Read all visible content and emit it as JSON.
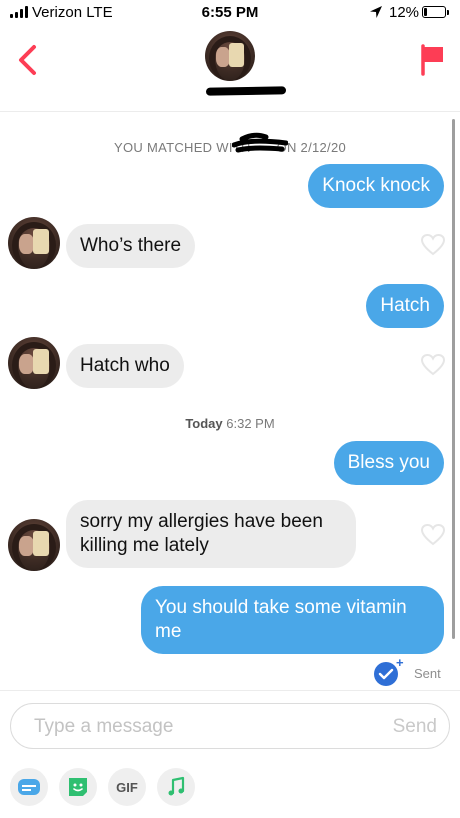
{
  "status_bar": {
    "carrier": "Verizon  LTE",
    "time": "6:55 PM",
    "battery": "12%"
  },
  "header": {
    "back_icon": "chevron-left-icon",
    "report_icon": "flag-icon",
    "accent": "#fd3d55"
  },
  "chat": {
    "match_text": "YOU MATCHED WITH",
    "match_date": "ON 2/12/20",
    "date_separator_day": "Today",
    "date_separator_time": "6:32 PM",
    "messages": [
      {
        "from": "me",
        "text": "Knock knock"
      },
      {
        "from": "them",
        "text": "Who’s there"
      },
      {
        "from": "me",
        "text": "Hatch"
      },
      {
        "from": "them",
        "text": "Hatch who"
      },
      {
        "from": "me",
        "text": "Bless you"
      },
      {
        "from": "them",
        "text": "sorry my allergies have been killing me lately"
      },
      {
        "from": "me",
        "text": "You should take some vitamin me"
      }
    ],
    "receipt": "Sent",
    "colors": {
      "outgoing": "#4aa7e8",
      "incoming": "#ececec",
      "receipt_check": "#2f6fd6"
    }
  },
  "composer": {
    "placeholder": "Type a message",
    "send_label": "Send",
    "tools": [
      {
        "icon": "card-icon"
      },
      {
        "icon": "sticker-icon"
      },
      {
        "label": "GIF"
      },
      {
        "icon": "music-note-icon"
      }
    ]
  }
}
